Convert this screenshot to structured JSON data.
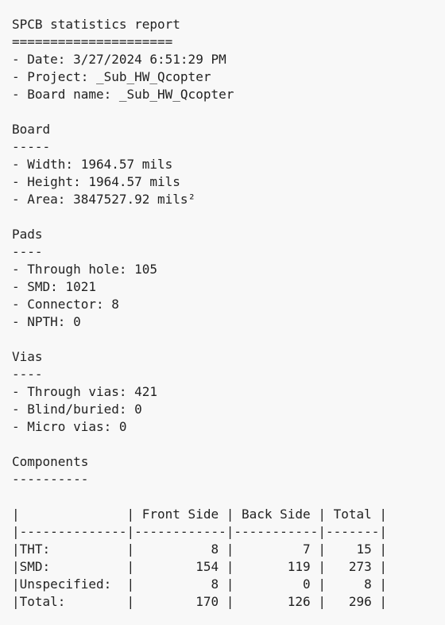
{
  "report": {
    "title": "SPCB statistics report",
    "title_rule": "=====================",
    "date": "- Date: 3/27/2024 6:51:29 PM",
    "project": "- Project: _Sub_HW_Qcopter",
    "board_name": "- Board name: _Sub_HW_Qcopter"
  },
  "board": {
    "heading": "Board",
    "rule": "-----",
    "width": "- Width: 1964.57 mils",
    "height": "- Height: 1964.57 mils",
    "area": "- Area: 3847527.92 mils²"
  },
  "pads": {
    "heading": "Pads",
    "rule": "----",
    "through_hole": "- Through hole: 105",
    "smd": "- SMD: 1021",
    "connector": "- Connector: 8",
    "npth": "- NPTH: 0"
  },
  "vias": {
    "heading": "Vias",
    "rule": "----",
    "through": "- Through vias: 421",
    "blind_buried": "- Blind/buried: 0",
    "micro": "- Micro vias: 0"
  },
  "components": {
    "heading": "Components",
    "rule": "----------",
    "table_lines": [
      "|              | Front Side | Back Side | Total |",
      "|--------------|------------|-----------|-------|",
      "|THT:          |          8 |         7 |    15 |",
      "|SMD:          |        154 |       119 |   273 |",
      "|Unspecified:  |          8 |         0 |     8 |",
      "|Total:        |        170 |       126 |   296 |"
    ]
  }
}
